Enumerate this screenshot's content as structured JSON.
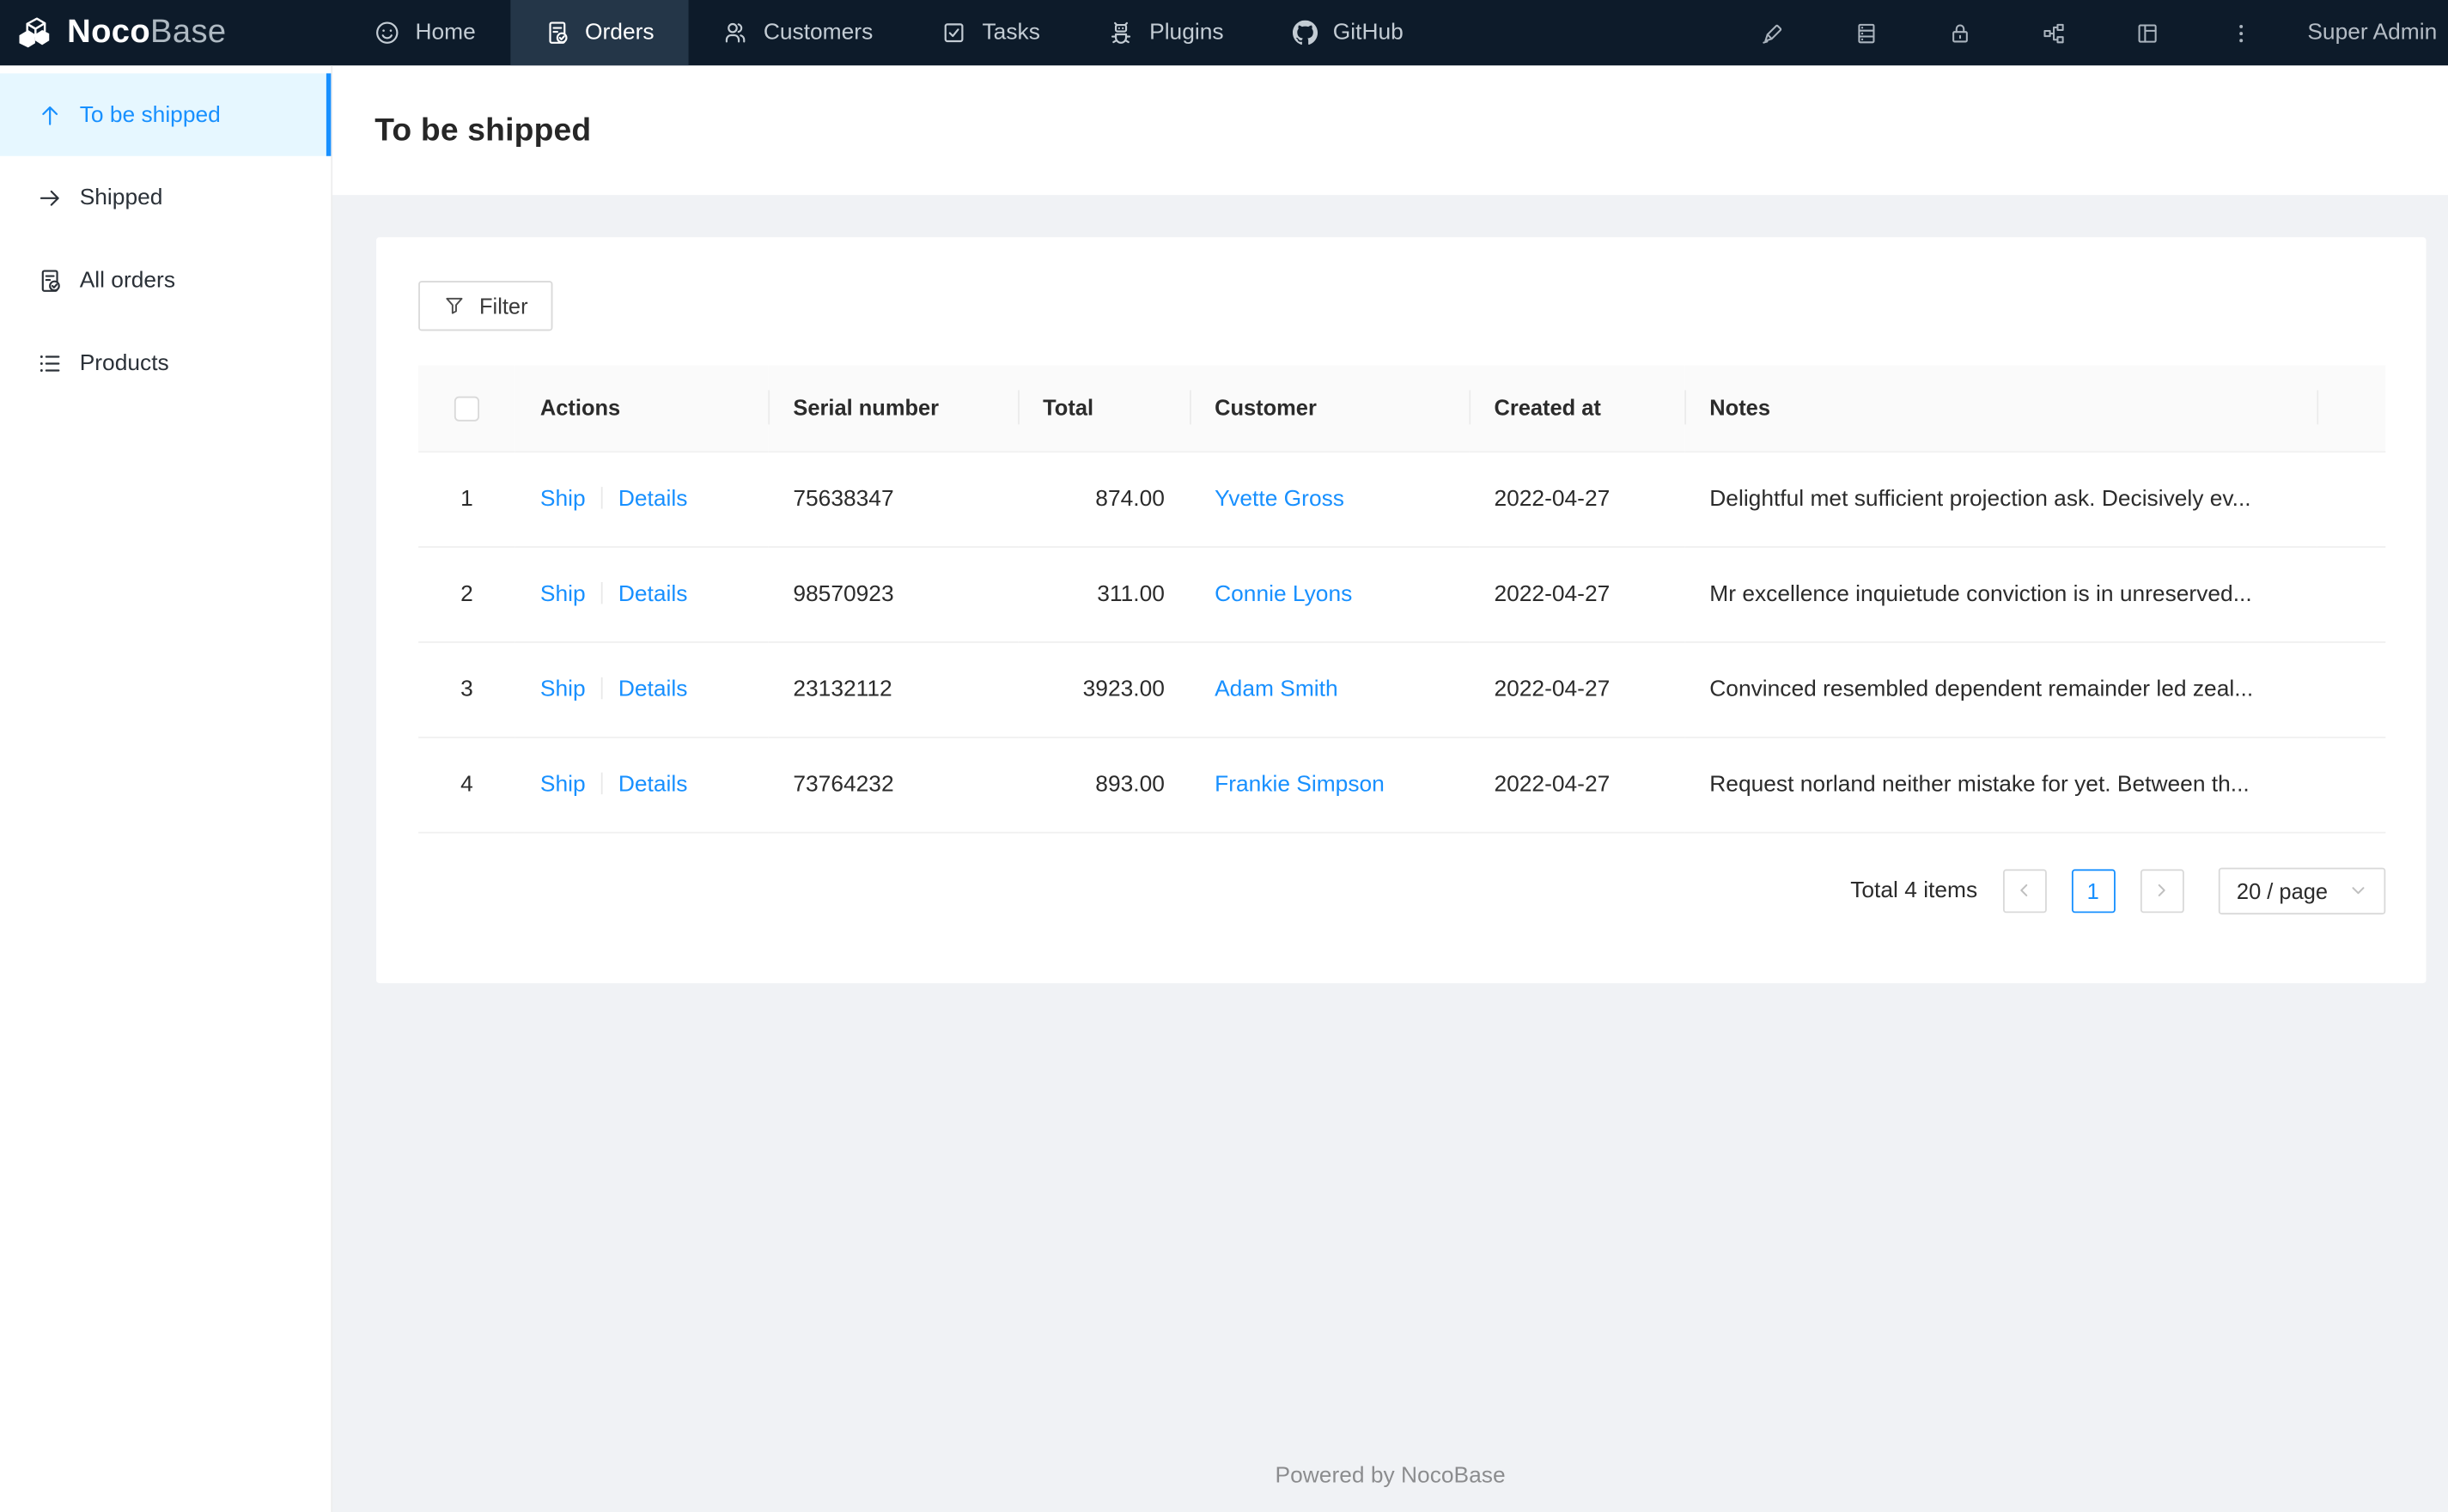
{
  "navbar": {
    "logo_bold": "Noco",
    "logo_light": "Base",
    "items": [
      {
        "label": "Home",
        "icon": "home-icon",
        "active": false
      },
      {
        "label": "Orders",
        "icon": "orders-icon",
        "active": true
      },
      {
        "label": "Customers",
        "icon": "customers-icon",
        "active": false
      },
      {
        "label": "Tasks",
        "icon": "tasks-icon",
        "active": false
      },
      {
        "label": "Plugins",
        "icon": "plugins-icon",
        "active": false
      },
      {
        "label": "GitHub",
        "icon": "github-icon",
        "active": false
      }
    ],
    "right_icons": [
      "highlighter-icon",
      "database-icon",
      "lock-icon",
      "partition-icon",
      "layout-icon",
      "more-icon"
    ],
    "user": "Super Admin"
  },
  "sidebar": {
    "items": [
      {
        "label": "To be shipped",
        "icon": "arrow-up-icon",
        "active": true
      },
      {
        "label": "Shipped",
        "icon": "arrow-right-icon",
        "active": false
      },
      {
        "label": "All orders",
        "icon": "file-done-icon",
        "active": false
      },
      {
        "label": "Products",
        "icon": "list-icon",
        "active": false
      }
    ]
  },
  "page": {
    "title": "To be shipped"
  },
  "toolbar": {
    "filter_label": "Filter"
  },
  "table": {
    "columns": [
      "Actions",
      "Serial number",
      "Total",
      "Customer",
      "Created at",
      "Notes"
    ],
    "action_labels": [
      "Ship",
      "Details"
    ],
    "rows": [
      {
        "index": "1",
        "serial": "75638347",
        "total": "874.00",
        "customer": "Yvette Gross",
        "created_at": "2022-04-27",
        "notes": "Delightful met sufficient projection ask. Decisively ev..."
      },
      {
        "index": "2",
        "serial": "98570923",
        "total": "311.00",
        "customer": "Connie Lyons",
        "created_at": "2022-04-27",
        "notes": "Mr excellence inquietude conviction is in unreserved..."
      },
      {
        "index": "3",
        "serial": "23132112",
        "total": "3923.00",
        "customer": "Adam Smith",
        "created_at": "2022-04-27",
        "notes": "Convinced resembled dependent remainder led zeal..."
      },
      {
        "index": "4",
        "serial": "73764232",
        "total": "893.00",
        "customer": "Frankie Simpson",
        "created_at": "2022-04-27",
        "notes": "Request norland neither mistake for yet. Between th..."
      }
    ]
  },
  "pagination": {
    "total_text": "Total 4 items",
    "current_page": "1",
    "page_size": "20 / page"
  },
  "footer": {
    "text": "Powered by NocoBase"
  },
  "colors": {
    "accent": "#1890ff",
    "navbar_bg": "#0d1b2a",
    "navbar_active_bg": "#243648",
    "sidebar_active_bg": "#e6f7ff",
    "content_bg": "#f0f2f5",
    "table_header_bg": "#fafafa"
  }
}
